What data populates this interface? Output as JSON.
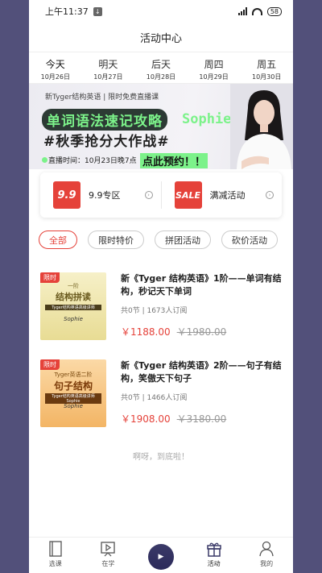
{
  "status_bar": {
    "time": "上午11:37",
    "battery": "58"
  },
  "header": {
    "title": "活动中心"
  },
  "dates": [
    {
      "day": "今天",
      "date": "10月26日"
    },
    {
      "day": "明天",
      "date": "10月27日"
    },
    {
      "day": "后天",
      "date": "10月28日"
    },
    {
      "day": "周四",
      "date": "10月29日"
    },
    {
      "day": "周五",
      "date": "10月30日"
    }
  ],
  "banner": {
    "subtitle": "新Tyger结构英语 | 限时免费直播课",
    "title_line1": "单词语法速记攻略",
    "sophie": "Sophie",
    "title_line2": "#秋季抢分大作战#",
    "time": "直播时间：10月23日晚7点",
    "cta": "点此预约！！"
  },
  "promo": [
    {
      "badge": "9.9",
      "label": "9.9专区",
      "color": "#e5423a"
    },
    {
      "badge": "SALE",
      "label": "满减活动",
      "color": "#e5423a"
    }
  ],
  "filters": [
    "全部",
    "限时特价",
    "拼团活动",
    "砍价活动"
  ],
  "courses": [
    {
      "tag": "限时",
      "cover_line1": "一阶",
      "cover_line2": "结构拼读",
      "cover_line3": "Tyger结构英语高级讲师",
      "cover_line4": "Sophie",
      "title": "新《Tyger 结构英语》1阶——单词有结构，秒记天下单词",
      "meta": "共0节 | 1673人订阅",
      "price": "￥1188.00",
      "original_price": "￥1980.00"
    },
    {
      "tag": "限时",
      "cover_line1": "Tyger英语二阶",
      "cover_line2": "句子结构",
      "cover_line3": "Tyger结构英语高级讲师Sophie",
      "cover_line4": "Sophie",
      "title": "新《Tyger 结构英语》2阶——句子有结构，笑傲天下句子",
      "meta": "共0节 | 1466人订阅",
      "price": "￥1908.00",
      "original_price": "￥3180.00"
    }
  ],
  "end_text": "啊呀，到底啦！",
  "nav": [
    {
      "label": "选课",
      "icon": "book-icon"
    },
    {
      "label": "在学",
      "icon": "play-board-icon"
    },
    {
      "label": "",
      "icon": "center-logo-icon"
    },
    {
      "label": "活动",
      "icon": "gift-icon"
    },
    {
      "label": "我的",
      "icon": "person-icon"
    }
  ]
}
